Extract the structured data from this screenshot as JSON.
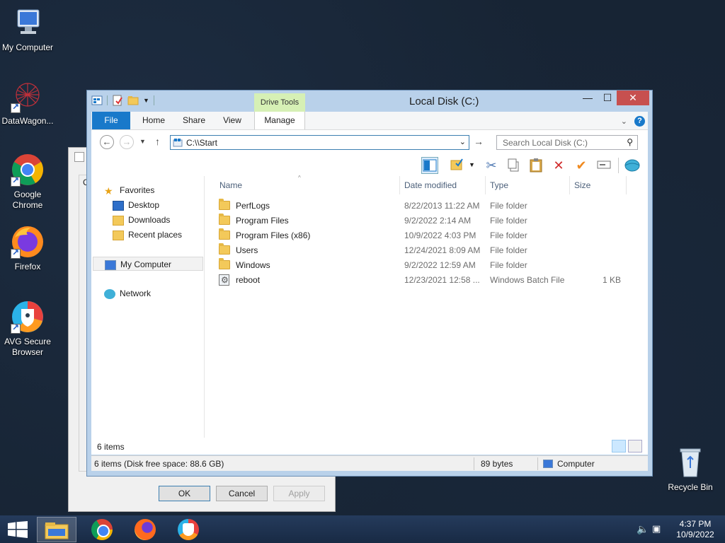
{
  "desktop": {
    "icons": [
      {
        "label": "My Computer",
        "icon": "computer-icon"
      },
      {
        "label": "DataWagon...",
        "icon": "datawagon-icon"
      },
      {
        "label": "Google Chrome",
        "icon": "chrome-icon"
      },
      {
        "label": "Firefox",
        "icon": "firefox-icon"
      },
      {
        "label": "AVG Secure Browser",
        "icon": "avg-icon"
      },
      {
        "label": "Recycle Bin",
        "icon": "recycle-bin-icon"
      }
    ]
  },
  "bg_dialog": {
    "partial_label": "C",
    "ok_label": "OK",
    "cancel_label": "Cancel",
    "apply_label": "Apply"
  },
  "window": {
    "title": "Local Disk (C:)",
    "context_tab_header": "Drive Tools",
    "tabs": {
      "file": "File",
      "home": "Home",
      "share": "Share",
      "view": "View",
      "manage": "Manage"
    },
    "address_value": "C:\\\\Start",
    "search_placeholder": "Search Local Disk (C:)",
    "nav": {
      "favorites": "Favorites",
      "desktop": "Desktop",
      "downloads": "Downloads",
      "recent": "Recent places",
      "my_computer": "My Computer",
      "network": "Network"
    },
    "columns": {
      "name": "Name",
      "date": "Date modified",
      "type": "Type",
      "size": "Size"
    },
    "files": [
      {
        "name": "PerfLogs",
        "date": "8/22/2013 11:22 AM",
        "type": "File folder",
        "size": ""
      },
      {
        "name": "Program Files",
        "date": "9/2/2022 2:14 AM",
        "type": "File folder",
        "size": ""
      },
      {
        "name": "Program Files (x86)",
        "date": "10/9/2022 4:03 PM",
        "type": "File folder",
        "size": ""
      },
      {
        "name": "Users",
        "date": "12/24/2021 8:09 AM",
        "type": "File folder",
        "size": ""
      },
      {
        "name": "Windows",
        "date": "9/2/2022 12:59 AM",
        "type": "File folder",
        "size": ""
      },
      {
        "name": "reboot",
        "date": "12/23/2021 12:58 ...",
        "type": "Windows Batch File",
        "size": "1 KB"
      }
    ],
    "item_count": "6 items",
    "details": {
      "summary": "6 items (Disk free space: 88.6 GB)",
      "bytes": "89 bytes",
      "location": "Computer"
    }
  },
  "taskbar": {
    "time": "4:37 PM",
    "date": "10/9/2022"
  }
}
